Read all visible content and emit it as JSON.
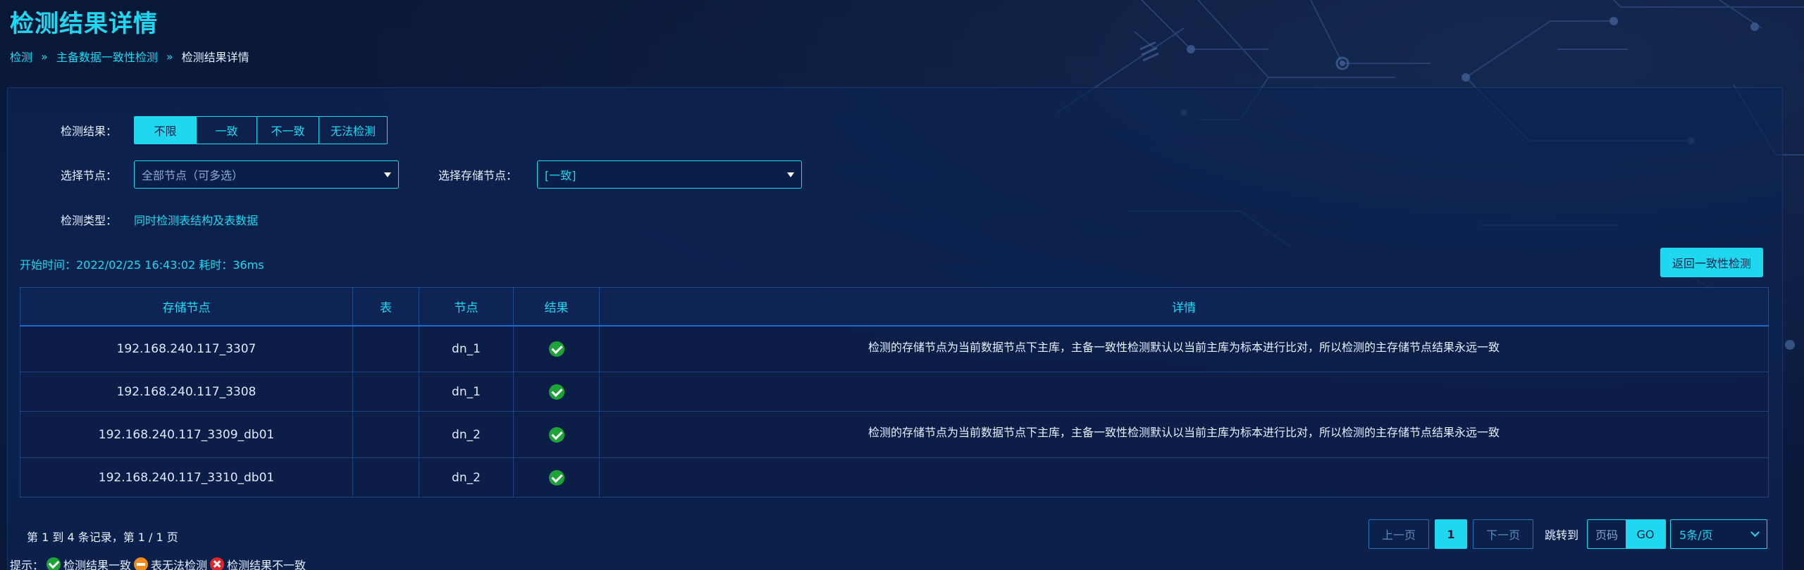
{
  "page": {
    "title": "检测结果详情"
  },
  "breadcrumb": {
    "items": [
      "检测",
      "主备数据一致性检测"
    ],
    "current": "检测结果详情"
  },
  "filters": {
    "result_label": "检测结果：",
    "result_options": [
      "不限",
      "一致",
      "不一致",
      "无法检测"
    ],
    "result_selected": "不限",
    "node_label": "选择节点：",
    "node_placeholder": "全部节点（可多选）",
    "storage_label": "选择存储节点：",
    "storage_value": "[一致]",
    "type_label": "检测类型：",
    "type_value": "同时检测表结构及表数据"
  },
  "meta": {
    "start_time_text": "开始时间：2022/02/25 16:43:02 耗时：36ms"
  },
  "actions": {
    "back_label": "返回一致性检测"
  },
  "table": {
    "headers": [
      "存储节点",
      "表",
      "节点",
      "结果",
      "详情"
    ],
    "rows": [
      {
        "storage": "192.168.240.117_3307",
        "table": "",
        "node": "dn_1",
        "result": "ok",
        "detail": "检测的存储节点为当前数据节点下主库，主备一致性检测默认以当前主库为标本进行比对，所以检测的主存储节点结果永远一致"
      },
      {
        "storage": "192.168.240.117_3308",
        "table": "",
        "node": "dn_1",
        "result": "ok",
        "detail": ""
      },
      {
        "storage": "192.168.240.117_3309_db01",
        "table": "",
        "node": "dn_2",
        "result": "ok",
        "detail": "检测的存储节点为当前数据节点下主库，主备一致性检测默认以当前主库为标本进行比对，所以检测的主存储节点结果永远一致"
      },
      {
        "storage": "192.168.240.117_3310_db01",
        "table": "",
        "node": "dn_2",
        "result": "ok",
        "detail": ""
      }
    ]
  },
  "pagination": {
    "summary": "第 1 到 4 条记录，第 1 / 1 页",
    "prev_label": "上一页",
    "current_page": "1",
    "next_label": "下一页",
    "jump_label": "跳转到",
    "page_input_placeholder": "页码",
    "go_label": "GO",
    "page_size": "5条/页"
  },
  "legend": {
    "prefix": "提示：",
    "consistent": "检测结果一致",
    "cannot_check": "表无法检测",
    "inconsistent": "检测结果不一致"
  },
  "colors": {
    "accent": "#1fd8f0",
    "background": "#0b1a3c",
    "ok": "#1ea338",
    "warn": "#f08a1c",
    "error": "#e0262b"
  }
}
